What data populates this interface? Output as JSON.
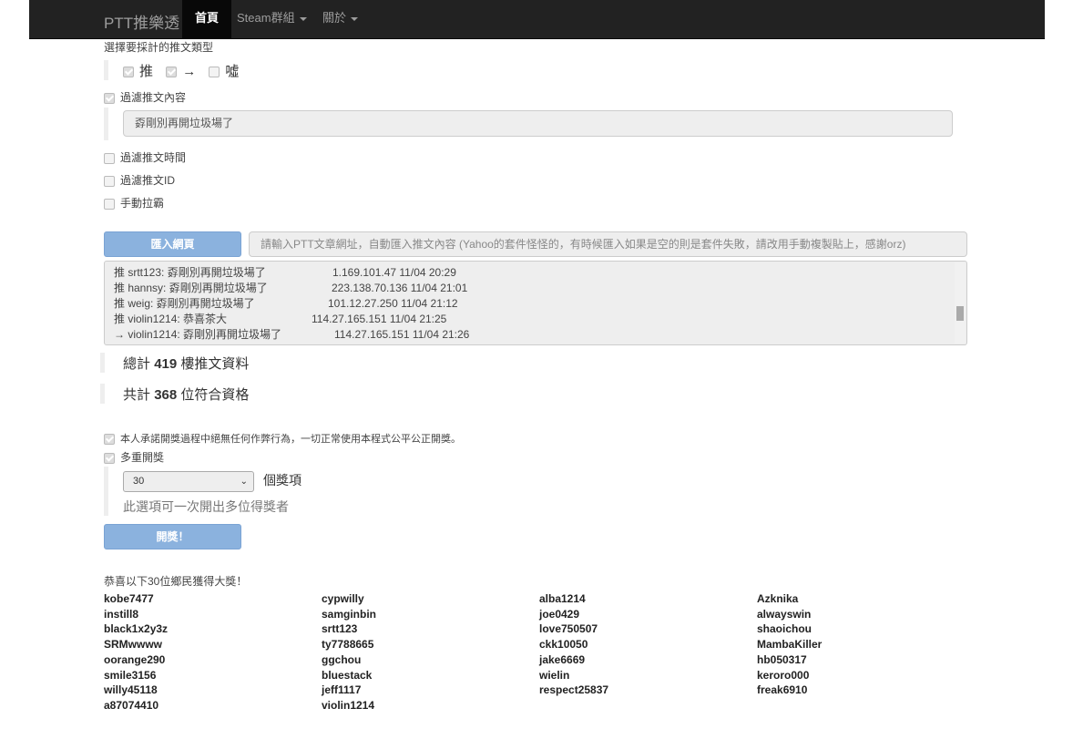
{
  "nav": {
    "brand": "PTT推樂透",
    "items": [
      {
        "label": "首頁",
        "active": true
      },
      {
        "label": "Steam群組"
      },
      {
        "label": "關於"
      }
    ]
  },
  "form": {
    "type_label": "選擇要採計的推文類型",
    "types": [
      {
        "label": "推",
        "checked": true
      },
      {
        "label": "→",
        "checked": true
      },
      {
        "label": "噓",
        "checked": false
      }
    ],
    "filter_content": {
      "label": "過濾推文內容",
      "checked": true,
      "value": "孬剛別再開垃圾場了"
    },
    "filter_time": {
      "label": "過濾推文時間",
      "checked": false
    },
    "filter_id": {
      "label": "過濾推文ID",
      "checked": false
    },
    "manual": {
      "label": "手動拉霸",
      "checked": false
    },
    "import_button": "匯入網頁",
    "url_placeholder": "請輸入PTT文章網址，自動匯入推文內容 (Yahoo的套件怪怪的，有時候匯入如果是空的則是套件失敗，請改用手動複製貼上，感謝orz)",
    "comments": [
      {
        "text": "推 srtt123: 孬剛別再開垃圾場了",
        "meta": "1.169.101.47 11/04 20:29"
      },
      {
        "text": "推 hannsy: 孬剛別再開垃圾場了",
        "meta": "223.138.70.136 11/04 21:01"
      },
      {
        "text": "推 weig: 孬剛別再開垃圾場了",
        "meta": "101.12.27.250 11/04 21:12"
      },
      {
        "text": "推 violin1214: 恭喜茶大",
        "meta": "114.27.165.151 11/04 21:25"
      },
      {
        "text": "→ violin1214: 孬剛別再開垃圾場了",
        "meta": "114.27.165.151 11/04 21:26"
      }
    ],
    "total_prefix": "總計",
    "total_count": "419",
    "total_suffix": "樓推文資料",
    "valid_prefix": "共計",
    "valid_count": "368",
    "valid_suffix": "位符合資格",
    "pledge": {
      "label": "本人承諾開獎過程中絕無任何作弊行為，一切正常使用本程式公平公正開獎。",
      "checked": true
    },
    "multi": {
      "label": "多重開獎",
      "checked": true
    },
    "prize_count": "30",
    "prize_unit": "個獎項",
    "prize_hint": "此選項可一次開出多位得獎者",
    "draw_button": "開獎！"
  },
  "results": {
    "title": "恭喜以下30位鄉民獲得大獎！",
    "columns": [
      [
        "kobe7477",
        "instill8",
        "black1x2y3z",
        "SRMwwww",
        "oorange290",
        "smile3156",
        "willy45118",
        "a87074410"
      ],
      [
        "cypwilly",
        "samginbin",
        "srtt123",
        "ty7788665",
        "ggchou",
        "bluestack",
        "jeff1117",
        "violin1214"
      ],
      [
        "alba1214",
        "joe0429",
        "love750507",
        "ckk10050",
        "jake6669",
        "wielin",
        "respect25837"
      ],
      [
        "Azknika",
        "alwayswin",
        "shaoichou",
        "MambaKiller",
        "hb050317",
        "keroro000",
        "freak6910"
      ]
    ]
  }
}
